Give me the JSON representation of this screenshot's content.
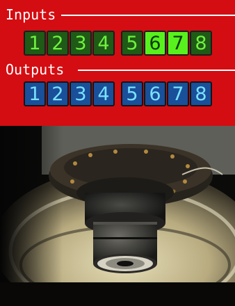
{
  "inputs": {
    "label": "Inputs",
    "channels": [
      {
        "label": "1",
        "active": false
      },
      {
        "label": "2",
        "active": false
      },
      {
        "label": "3",
        "active": false
      },
      {
        "label": "4",
        "active": false
      },
      {
        "label": "5",
        "active": false
      },
      {
        "label": "6",
        "active": true
      },
      {
        "label": "7",
        "active": true
      },
      {
        "label": "8",
        "active": false
      }
    ]
  },
  "outputs": {
    "label": "Outputs",
    "channels": [
      {
        "label": "1",
        "active": false
      },
      {
        "label": "2",
        "active": false
      },
      {
        "label": "3",
        "active": false
      },
      {
        "label": "4",
        "active": false
      },
      {
        "label": "5",
        "active": false
      },
      {
        "label": "6",
        "active": false
      },
      {
        "label": "7",
        "active": false
      },
      {
        "label": "8",
        "active": false
      }
    ]
  },
  "colors": {
    "panel_background": "#d40d12",
    "input_inactive": "#1f5a16",
    "input_active": "#58f11d",
    "output_inactive": "#1a4f9a",
    "output_digit": "#79e2ff"
  },
  "camera": {
    "subject": "machine-spindle-camera-feed"
  }
}
